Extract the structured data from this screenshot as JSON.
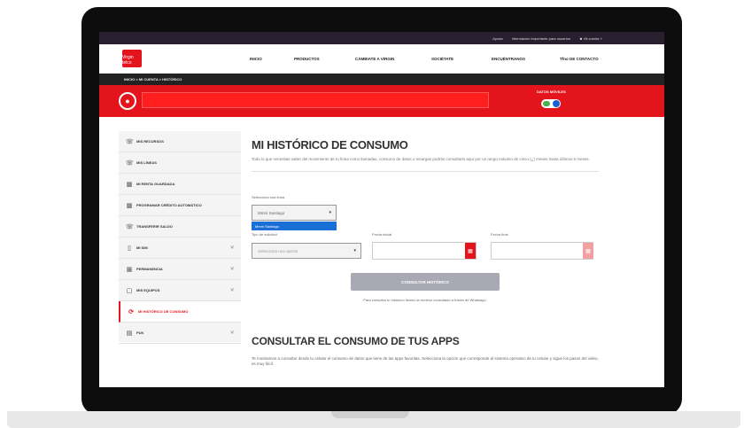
{
  "topbar": {
    "help": "Ayuda",
    "info": "Información importante para usuarios",
    "account": "Mi cuenta"
  },
  "brand": {
    "logo_text": "Virgin telco",
    "accent": "#e3141c"
  },
  "nav": {
    "items": [
      "INICIO",
      "PRODUCTOS",
      "CÁMBIATE A VIRGIN",
      "SOCIÉTATE",
      "ENCUÉNTRANOS",
      "Tfno DE CONTACTO"
    ]
  },
  "breadcrumb": "INICIO > MI CUENTA > HISTÓRICO",
  "hero": {
    "toggle_label": "DATOS MÓVILES"
  },
  "sidebar": {
    "items": [
      {
        "label": "MIS RECURSOS",
        "icon": "phone-icon"
      },
      {
        "label": "MIS LÍNEAS",
        "icon": "phone-icon"
      },
      {
        "label": "MI RENTA GUARDADA",
        "icon": "gift-icon"
      },
      {
        "label": "PROGRAMAR CRÉDITO AUTOMÁTICO",
        "icon": "gift-icon"
      },
      {
        "label": "TRANSFERIR SALDO",
        "icon": "phone-icon"
      },
      {
        "label": "MI SIM",
        "icon": "sim-icon"
      },
      {
        "label": "PERMANENCIA",
        "icon": "document-icon"
      },
      {
        "label": "MIS EQUIPOS",
        "icon": "device-icon"
      },
      {
        "label": "MI HISTÓRICO DE CONSUMO",
        "icon": "history-icon"
      },
      {
        "label": "PUK",
        "icon": "lock-icon"
      }
    ]
  },
  "main": {
    "title": "MI HISTÓRICO DE CONSUMO",
    "description": "Todo lo que necesitas saber del movimiento de tu línea como llamadas, consumo de datos o recargas podrás consultarlo aquí por un rango máximo de cinco (¿) meses hasta últimos 6 meses.",
    "line_select_label": "Selecciona una línea",
    "line_select_value": "Mmm Santiago",
    "line_option": "Mmm Santiago",
    "type_label": "Tipo de solicitud",
    "type_placeholder": "Selecciona una opción",
    "date_start_label": "Fecha inicial",
    "date_end_label": "Fecha final",
    "submit_label": "CONSULTAR HISTÓRICO",
    "hint": "Para consultar tu histórico tienes un mínimo consultado a través de Whatsapp.",
    "apps_title": "CONSULTAR EL CONSUMO DE TUS APPS",
    "apps_text": "Te mostramos a consultar desde tu celular el consumo de datos que tiene de las apps favoritas. Selecciona la opción que corresponde al sistema operativo de tu celular y sigue los pasos del video, es muy fácil."
  }
}
